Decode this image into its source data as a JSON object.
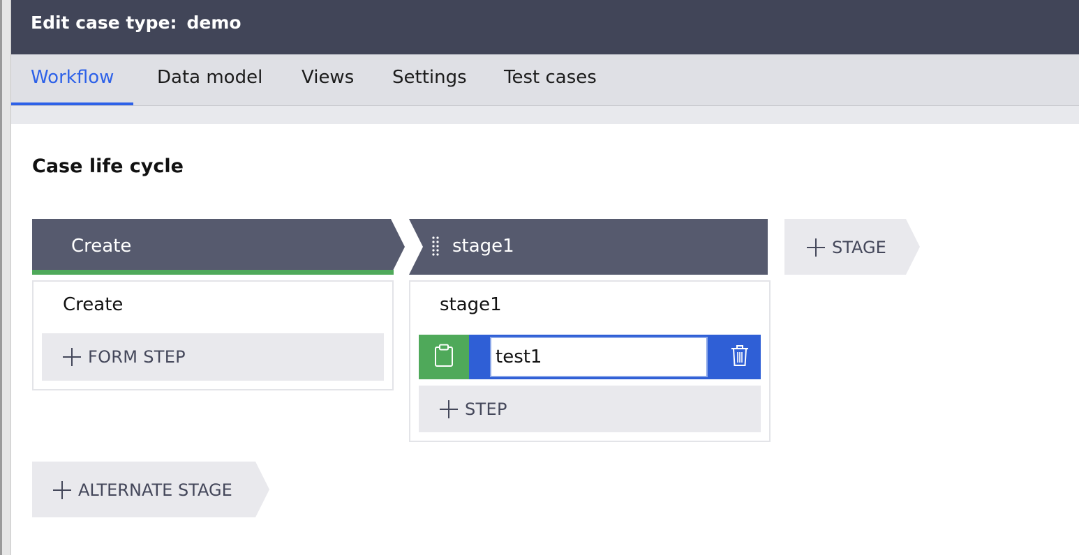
{
  "header": {
    "title_label": "Edit case type:",
    "case_type_name": "demo"
  },
  "tabs": [
    {
      "label": "Workflow",
      "active": true
    },
    {
      "label": "Data model",
      "active": false
    },
    {
      "label": "Views",
      "active": false
    },
    {
      "label": "Settings",
      "active": false
    },
    {
      "label": "Test cases",
      "active": false
    }
  ],
  "main": {
    "section_title": "Case life cycle",
    "stages": [
      {
        "header_label": "Create",
        "panel_title": "Create",
        "add_label": "FORM STEP"
      },
      {
        "header_label": "stage1",
        "panel_title": "stage1",
        "step_value": "test1",
        "add_label": "STEP"
      }
    ],
    "add_stage_label": "STAGE",
    "add_alternate_stage_label": "ALTERNATE STAGE"
  },
  "colors": {
    "header_bg": "#414558",
    "accent_blue": "#2d61e8",
    "stage_bg": "#565a6e",
    "create_underline": "#4fa95a",
    "step_green": "#4fa95a",
    "step_blue": "#2f5fd6"
  },
  "icons": [
    "drag-handle-icon",
    "clipboard-icon",
    "trash-icon",
    "plus-icon"
  ]
}
